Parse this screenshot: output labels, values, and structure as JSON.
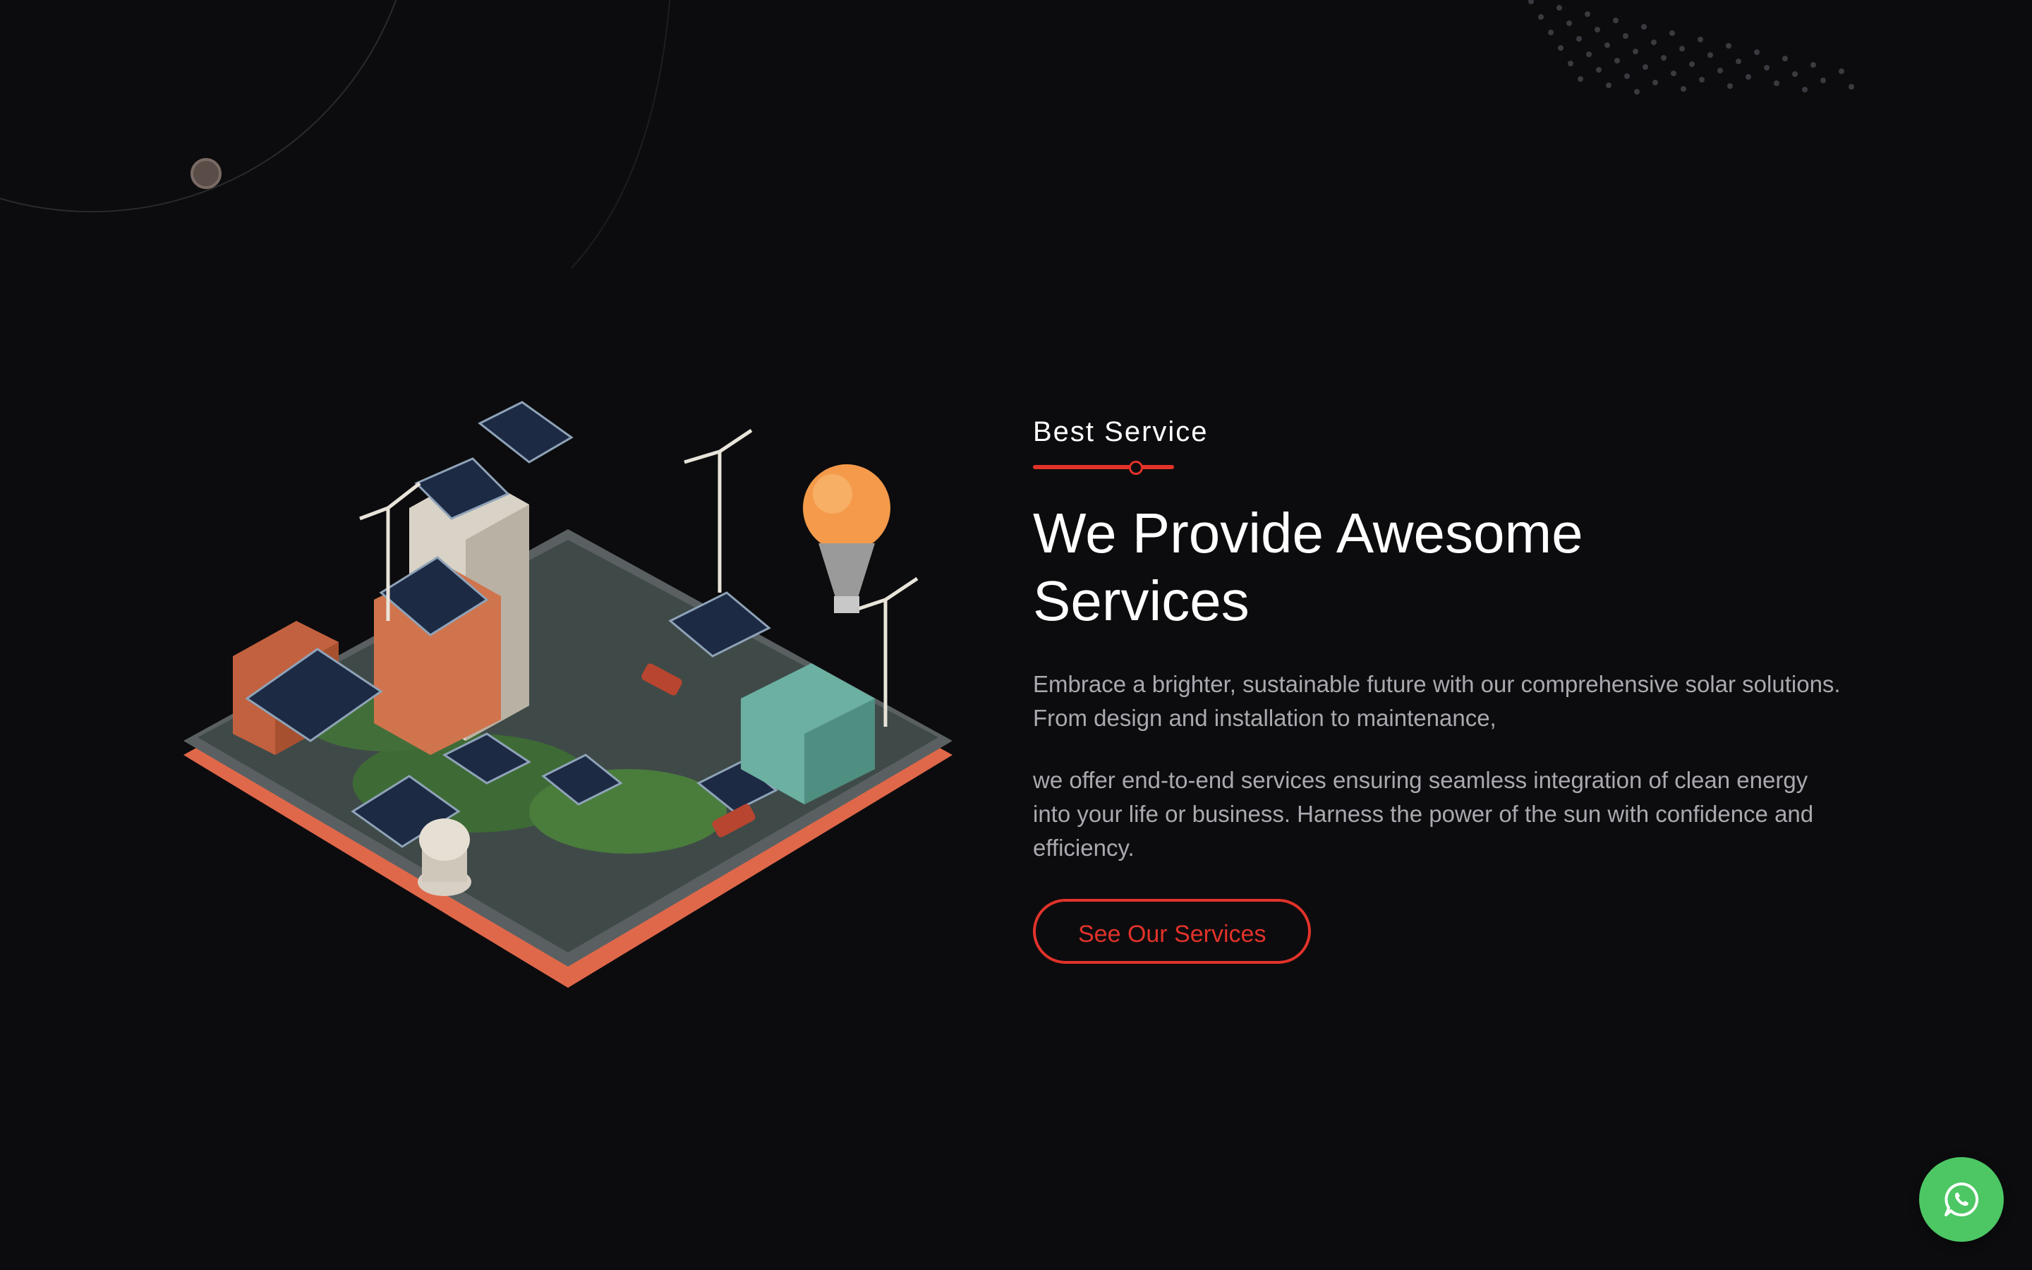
{
  "section": {
    "eyebrow": "Best Service",
    "title": "We Provide Awesome Services",
    "paragraph_1": "Embrace a brighter, sustainable future with our comprehensive solar solutions. From design and installation to maintenance,",
    "paragraph_2": "we offer end-to-end services ensuring seamless integration of clean energy into your life or business. Harness the power of the sun with confidence and efficiency.",
    "cta_label": "See Our Services"
  },
  "illustration": {
    "alt": "Isometric city with solar panels and wind turbines"
  },
  "floating": {
    "whatsapp_icon": "whatsapp-icon"
  },
  "colors": {
    "background": "#0c0c0e",
    "accent": "#e2322a",
    "text_primary": "#ffffff",
    "text_secondary": "#a9a9b0",
    "whatsapp": "#4cc764"
  }
}
